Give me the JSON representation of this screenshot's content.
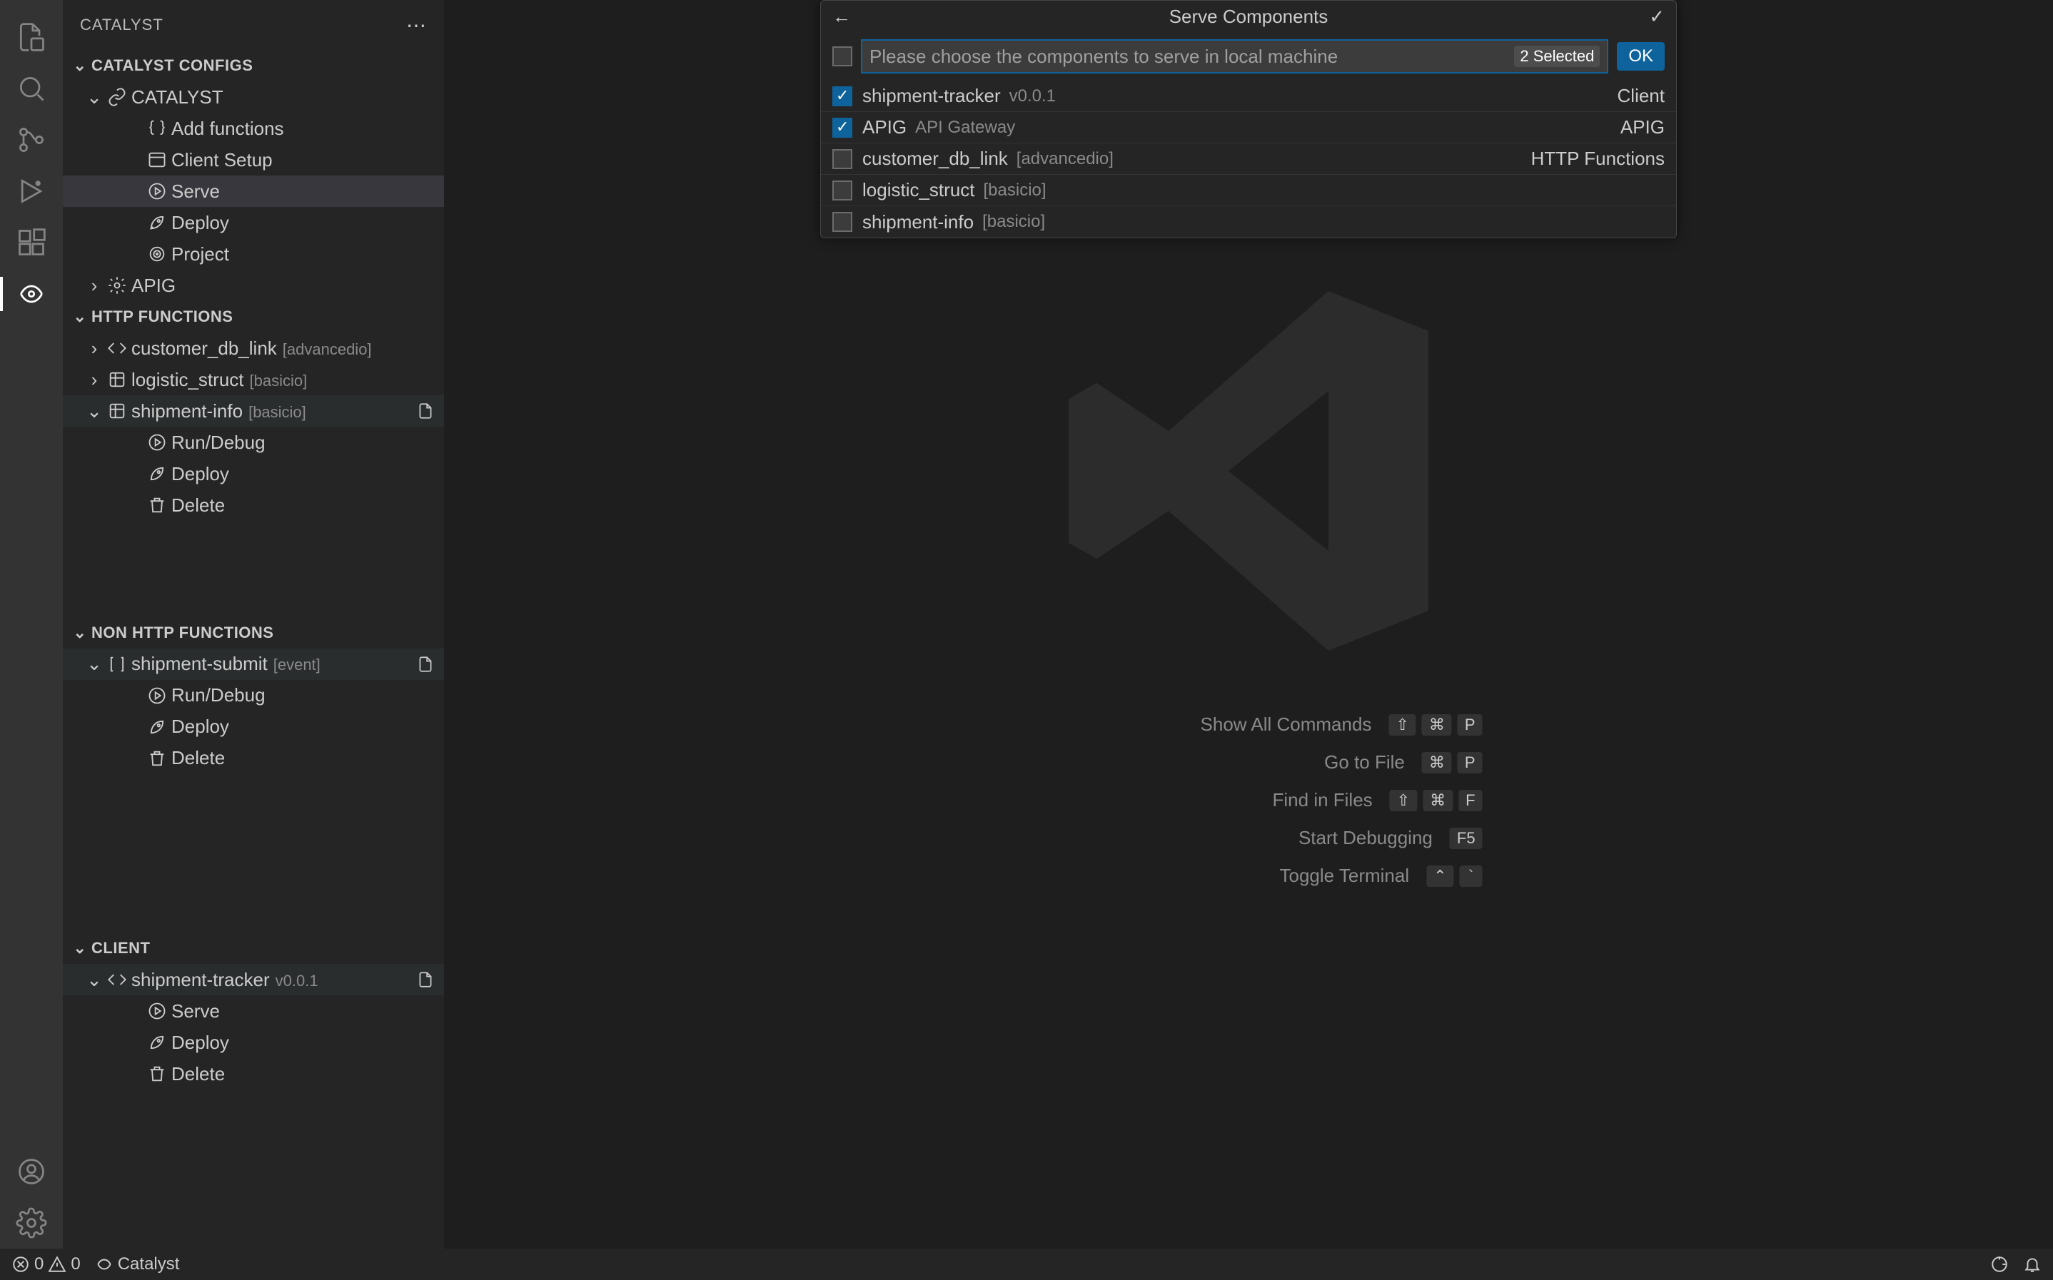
{
  "sidebar": {
    "title": "CATALYST",
    "sections": {
      "configs": {
        "title": "CATALYST CONFIGS"
      },
      "http": {
        "title": "HTTP FUNCTIONS"
      },
      "nonhttp": {
        "title": "NON HTTP FUNCTIONS"
      },
      "client": {
        "title": "CLIENT"
      }
    },
    "catalyst": {
      "label": "CATALYST",
      "add_functions": "Add functions",
      "client_setup": "Client Setup",
      "serve": "Serve",
      "deploy": "Deploy",
      "project": "Project",
      "apig": "APIG"
    },
    "httpfns": {
      "customer_db": {
        "label": "customer_db_link",
        "desc": "[advancedio]"
      },
      "logistic": {
        "label": "logistic_struct",
        "desc": "[basicio]"
      },
      "shipinfo": {
        "label": "shipment-info",
        "desc": "[basicio]",
        "run": "Run/Debug",
        "deploy": "Deploy",
        "delete": "Delete"
      }
    },
    "nonhttpfns": {
      "shipsubmit": {
        "label": "shipment-submit",
        "desc": "[event]",
        "run": "Run/Debug",
        "deploy": "Deploy",
        "delete": "Delete"
      }
    },
    "clients": {
      "tracker": {
        "label": "shipment-tracker",
        "desc": "v0.0.1",
        "serve": "Serve",
        "deploy": "Deploy",
        "delete": "Delete"
      }
    }
  },
  "quickinput": {
    "title": "Serve Components",
    "placeholder": "Please choose the components to serve in local machine",
    "badge": "2 Selected",
    "ok": "OK",
    "items": [
      {
        "checked": true,
        "name": "shipment-tracker",
        "desc": "v0.0.1",
        "right": "Client"
      },
      {
        "checked": true,
        "name": "APIG",
        "desc": "API Gateway",
        "right": "APIG"
      },
      {
        "checked": false,
        "name": "customer_db_link",
        "desc": "[advancedio]",
        "right": "HTTP Functions"
      },
      {
        "checked": false,
        "name": "logistic_struct",
        "desc": "[basicio]",
        "right": ""
      },
      {
        "checked": false,
        "name": "shipment-info",
        "desc": "[basicio]",
        "right": ""
      }
    ]
  },
  "watermark": [
    {
      "label": "Show All Commands",
      "keys": [
        "⇧",
        "⌘",
        "P"
      ]
    },
    {
      "label": "Go to File",
      "keys": [
        "⌘",
        "P"
      ]
    },
    {
      "label": "Find in Files",
      "keys": [
        "⇧",
        "⌘",
        "F"
      ]
    },
    {
      "label": "Start Debugging",
      "keys": [
        "F5"
      ]
    },
    {
      "label": "Toggle Terminal",
      "keys": [
        "⌃",
        "`"
      ]
    }
  ],
  "status": {
    "errors": "0",
    "warnings": "0",
    "catalyst": "Catalyst"
  }
}
